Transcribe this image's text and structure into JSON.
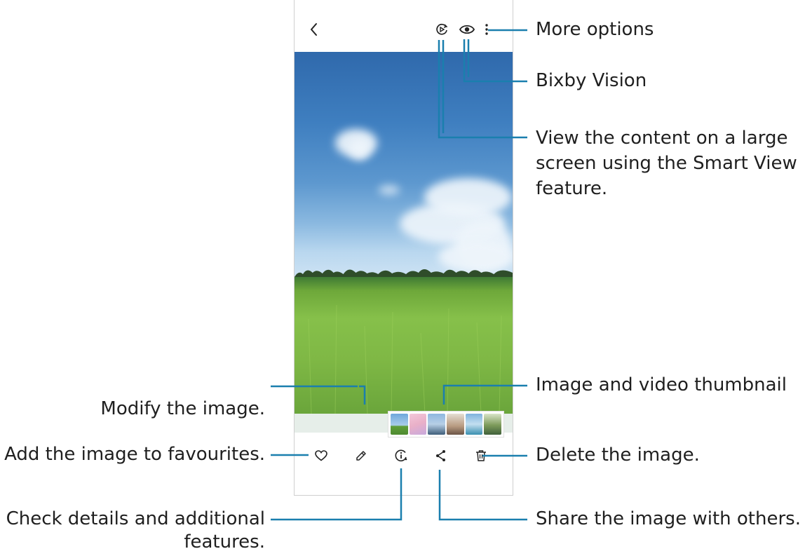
{
  "annotations": {
    "more_options": "More options",
    "bixby_vision": "Bixby Vision",
    "smart_view_line1": "View the content on a large",
    "smart_view_line2": "screen using the Smart View",
    "smart_view_line3": "feature.",
    "thumbnail": "Image and video thumbnail",
    "modify": "Modify the image.",
    "favourites": "Add the image to favourites.",
    "delete": "Delete the image.",
    "details_line1": "Check details and additional",
    "details_line2": "features.",
    "share": "Share the image with others."
  },
  "icons": {
    "back": "back-chevron-icon",
    "smart_view": "smart-view-icon",
    "bixby": "eye-icon",
    "more": "more-vertical-icon",
    "favourite": "heart-icon",
    "edit": "pencil-icon",
    "details": "info-icon",
    "share": "share-icon",
    "delete": "trash-icon"
  },
  "colors": {
    "callout_line": "#1a7fae",
    "text": "#1f1f1f"
  }
}
